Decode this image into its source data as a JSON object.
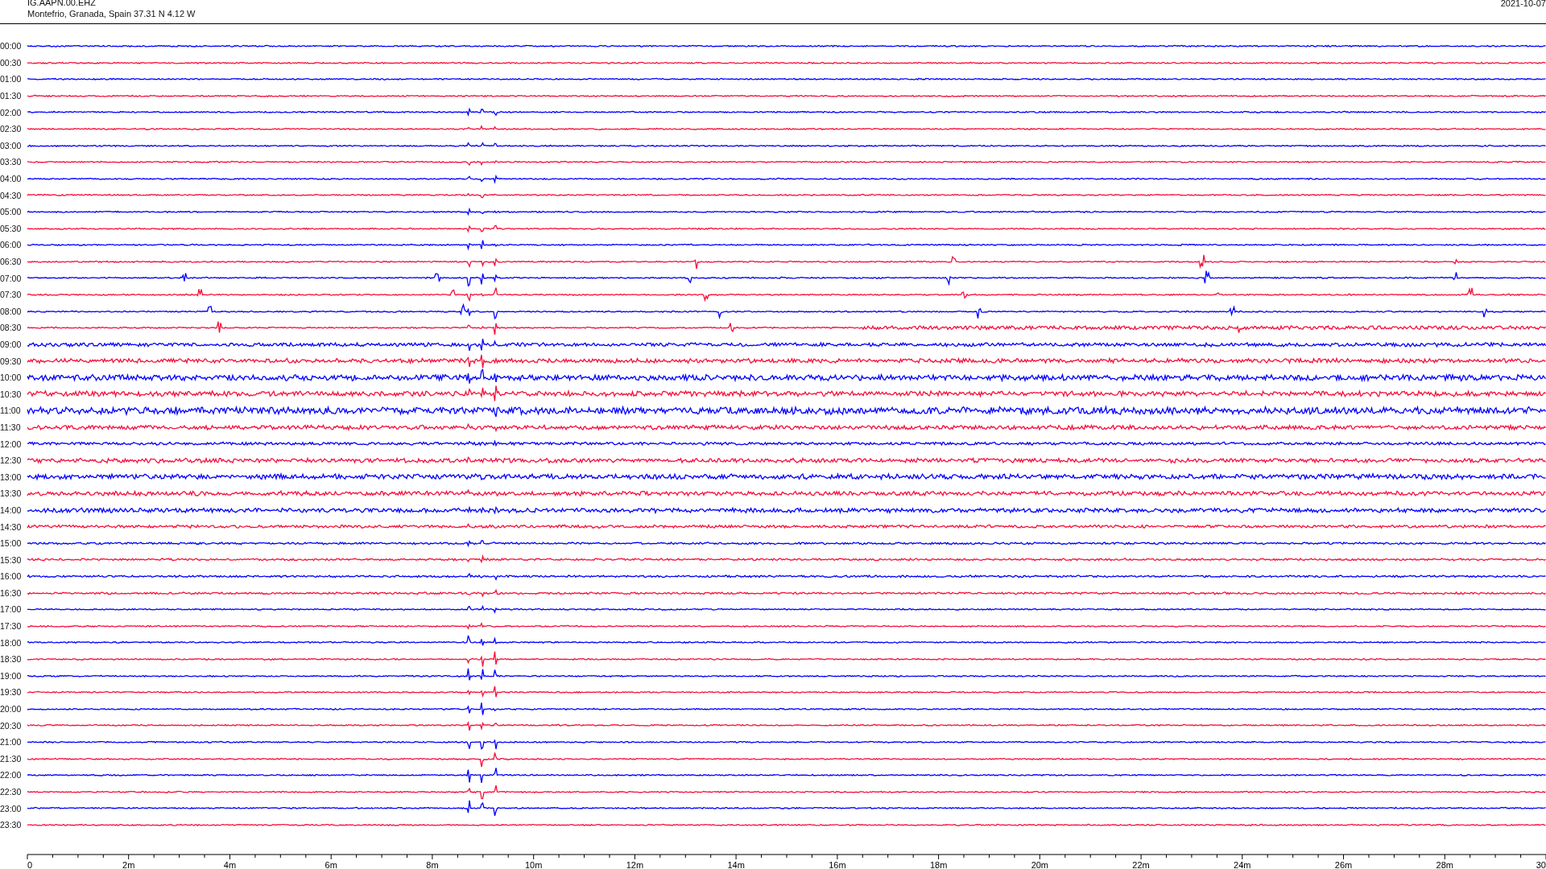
{
  "header": {
    "station": "IG.AAPN.00.EHZ",
    "location": "Montefrio, Granada, Spain  37.31 N 4.12 W",
    "date": "2021-10-07"
  },
  "traces": [
    {
      "label": "00:00",
      "color": "#0000ff"
    },
    {
      "label": "00:30",
      "color": "#f5103a"
    },
    {
      "label": "01:00",
      "color": "#0000ff"
    },
    {
      "label": "01:30",
      "color": "#f5103a"
    },
    {
      "label": "02:00",
      "color": "#0000ff"
    },
    {
      "label": "02:30",
      "color": "#f5103a"
    },
    {
      "label": "03:00",
      "color": "#0000ff"
    },
    {
      "label": "03:30",
      "color": "#f5103a"
    },
    {
      "label": "04:00",
      "color": "#0000ff"
    },
    {
      "label": "04:30",
      "color": "#f5103a"
    },
    {
      "label": "05:00",
      "color": "#0000ff"
    },
    {
      "label": "05:30",
      "color": "#f5103a"
    },
    {
      "label": "06:00",
      "color": "#0000ff"
    },
    {
      "label": "06:30",
      "color": "#f5103a"
    },
    {
      "label": "07:00",
      "color": "#0000ff"
    },
    {
      "label": "07:30",
      "color": "#f5103a"
    },
    {
      "label": "08:00",
      "color": "#0000ff"
    },
    {
      "label": "08:30",
      "color": "#f5103a"
    },
    {
      "label": "09:00",
      "color": "#0000ff"
    },
    {
      "label": "09:30",
      "color": "#f5103a"
    },
    {
      "label": "10:00",
      "color": "#0000ff"
    },
    {
      "label": "10:30",
      "color": "#f5103a"
    },
    {
      "label": "11:00",
      "color": "#0000ff"
    },
    {
      "label": "11:30",
      "color": "#f5103a"
    },
    {
      "label": "12:00",
      "color": "#0000ff"
    },
    {
      "label": "12:30",
      "color": "#f5103a"
    },
    {
      "label": "13:00",
      "color": "#0000ff"
    },
    {
      "label": "13:30",
      "color": "#f5103a"
    },
    {
      "label": "14:00",
      "color": "#0000ff"
    },
    {
      "label": "14:30",
      "color": "#f5103a"
    },
    {
      "label": "15:00",
      "color": "#0000ff"
    },
    {
      "label": "15:30",
      "color": "#f5103a"
    },
    {
      "label": "16:00",
      "color": "#0000ff"
    },
    {
      "label": "16:30",
      "color": "#f5103a"
    },
    {
      "label": "17:00",
      "color": "#0000ff"
    },
    {
      "label": "17:30",
      "color": "#f5103a"
    },
    {
      "label": "18:00",
      "color": "#0000ff"
    },
    {
      "label": "18:30",
      "color": "#f5103a"
    },
    {
      "label": "19:00",
      "color": "#0000ff"
    },
    {
      "label": "19:30",
      "color": "#f5103a"
    },
    {
      "label": "20:00",
      "color": "#0000ff"
    },
    {
      "label": "20:30",
      "color": "#f5103a"
    },
    {
      "label": "21:00",
      "color": "#0000ff"
    },
    {
      "label": "21:30",
      "color": "#f5103a"
    },
    {
      "label": "22:00",
      "color": "#0000ff"
    },
    {
      "label": "22:30",
      "color": "#f5103a"
    },
    {
      "label": "23:00",
      "color": "#0000ff"
    },
    {
      "label": "23:30",
      "color": "#f5103a"
    }
  ],
  "x_axis": {
    "ticks": [
      "0",
      "2m",
      "4m",
      "6m",
      "8m",
      "10m",
      "12m",
      "14m",
      "16m",
      "18m",
      "20m",
      "22m",
      "24m",
      "26m",
      "28m",
      "30"
    ]
  }
}
